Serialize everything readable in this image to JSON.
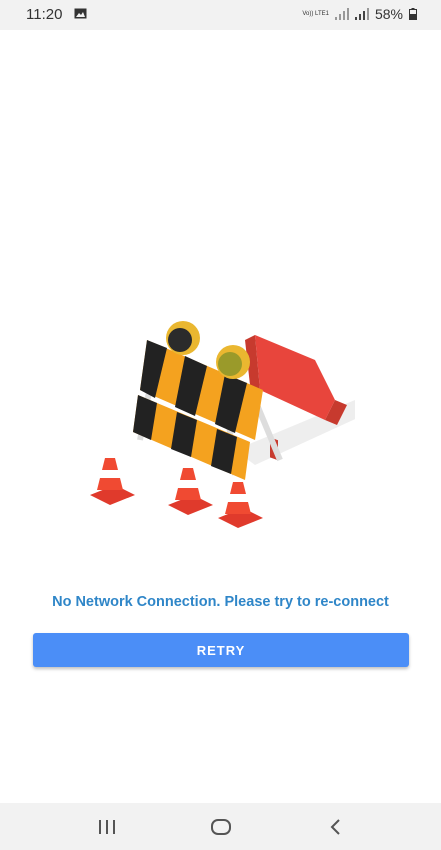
{
  "status_bar": {
    "time": "11:20",
    "volte": "Vo)) LTE1",
    "battery": "58%",
    "icons": [
      "gallery-icon",
      "volte-icon",
      "signal-icon",
      "signal-icon",
      "battery-icon"
    ]
  },
  "main": {
    "illustration": "construction-barrier-illustration",
    "message": "No Network Connection. Please try to re-connect",
    "retry_label": "RETRY"
  },
  "nav_bar": {
    "icons": [
      "recent-apps-icon",
      "home-icon",
      "back-icon"
    ]
  },
  "colors": {
    "message": "#2f86c8",
    "button": "#4b8ef7",
    "bars": "#f2f2f2"
  }
}
